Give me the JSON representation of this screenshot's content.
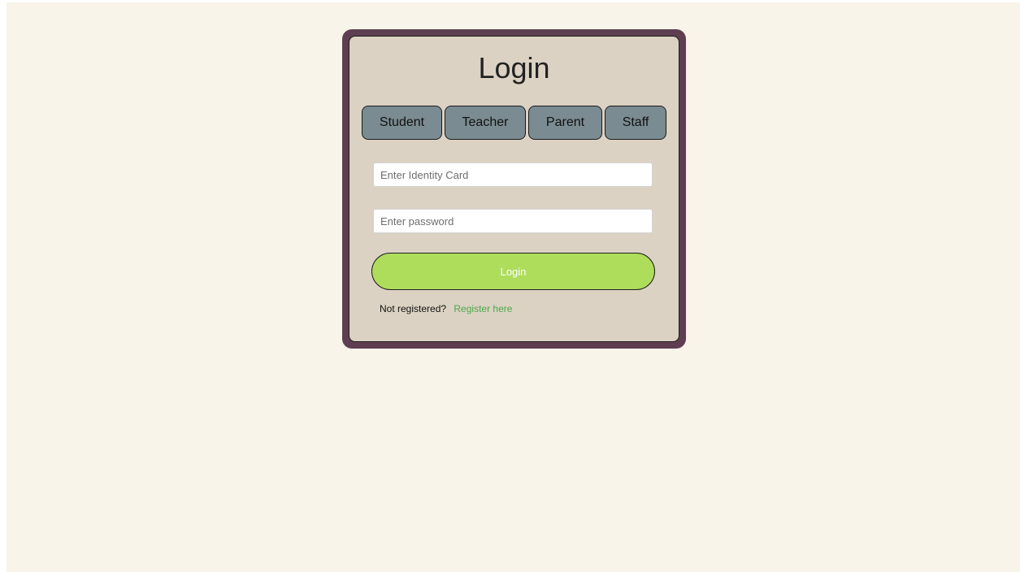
{
  "login": {
    "title": "Login",
    "tabs": [
      "Student",
      "Teacher",
      "Parent",
      "Staff"
    ],
    "identity_placeholder": "Enter Identity Card",
    "password_placeholder": "Enter password",
    "submit_label": "Login",
    "register_prompt": "Not registered?",
    "register_link": "Register here"
  },
  "colors": {
    "page_background": "#f8f4ea",
    "card_frame": "#5e3e50",
    "card_background": "#dcd2c3",
    "tab_background": "#7a8b91",
    "login_button": "#aedd5c",
    "register_link": "#4aa84a"
  }
}
